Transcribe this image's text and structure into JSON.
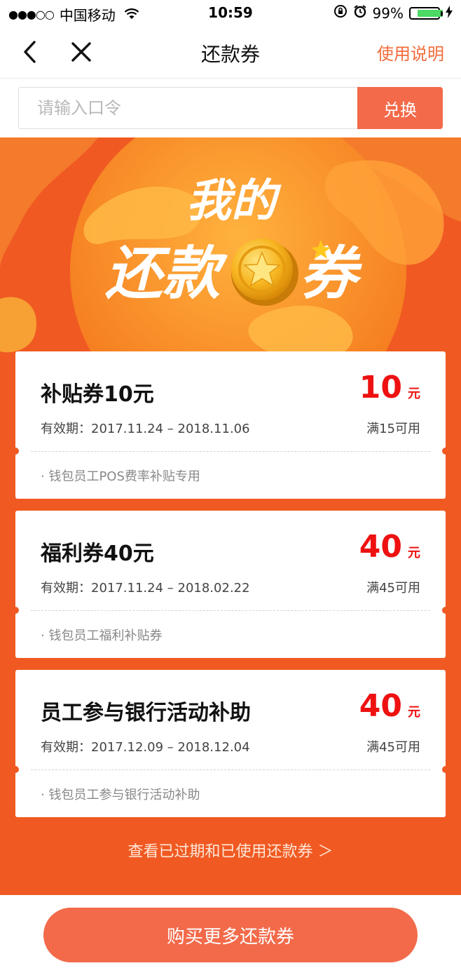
{
  "status_bar": {
    "signal": "●●●○○",
    "carrier": "中国移动",
    "time": "10:59",
    "battery": "99%"
  },
  "nav": {
    "title": "还款券",
    "help": "使用说明"
  },
  "redeem": {
    "placeholder": "请输入口令",
    "button": "兑换"
  },
  "banner": {
    "line1": "我的",
    "line2_a": "还款",
    "line2_b": "券"
  },
  "coupons": [
    {
      "name": "补贴券10元",
      "amount": "10",
      "unit": "元",
      "validity": "有效期：2017.11.24 – 2018.11.06",
      "condition": "满15可用",
      "desc": "· 钱包员工POS费率补贴专用"
    },
    {
      "name": "福利券40元",
      "amount": "40",
      "unit": "元",
      "validity": "有效期：2017.11.24 – 2018.02.22",
      "condition": "满45可用",
      "desc": "· 钱包员工福利补贴券"
    },
    {
      "name": "员工参与银行活动补助",
      "amount": "40",
      "unit": "元",
      "validity": "有效期：2017.12.09 – 2018.12.04",
      "condition": "满45可用",
      "desc": "· 钱包员工参与银行活动补助"
    }
  ],
  "expired_link": "查看已过期和已使用还款券 ＞",
  "buy_button": "购买更多还款券",
  "colors": {
    "accent": "#f26a4a",
    "background_orange": "#f05a22",
    "amount_red": "#ee1111",
    "battery_green": "#4cd964"
  }
}
